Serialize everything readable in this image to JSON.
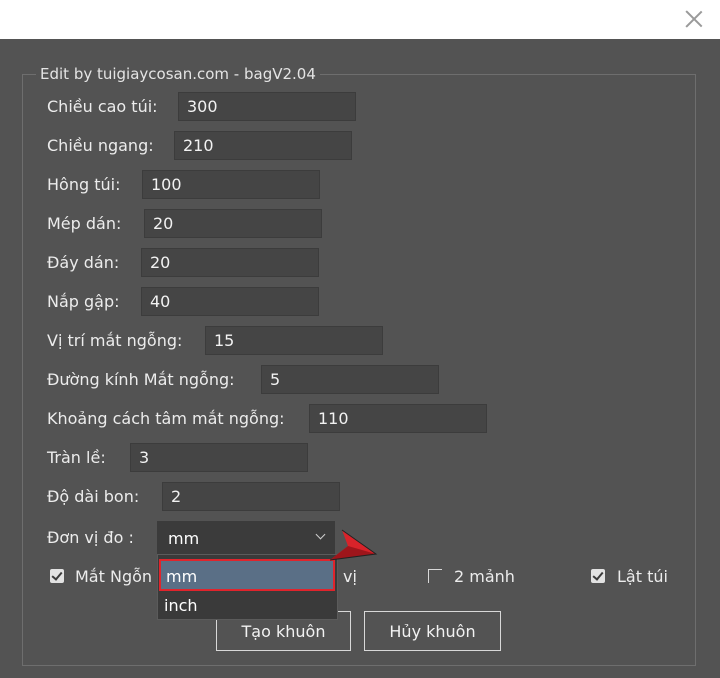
{
  "window": {
    "close_icon": "close-icon"
  },
  "group": {
    "title": "Edit by tuigiaycosan.com - bagV2.04"
  },
  "fields": [
    {
      "label": "Chiều cao túi:",
      "value": "300"
    },
    {
      "label": "Chiều ngang:",
      "value": "210"
    },
    {
      "label": "Hông túi:",
      "value": "100"
    },
    {
      "label": "Mép dán:",
      "value": "20"
    },
    {
      "label": "Đáy dán:",
      "value": "20"
    },
    {
      "label": "Nắp gập:",
      "value": "40"
    },
    {
      "label": "Vị trí mắt ngỗng:",
      "value": "15"
    },
    {
      "label": "Đường kính Mắt ngỗng:",
      "value": "5"
    },
    {
      "label": "Khoảng cách tâm mắt ngỗng:",
      "value": "110"
    },
    {
      "label": "Tràn lề:",
      "value": "3"
    },
    {
      "label": "Độ dài bon:",
      "value": "2"
    }
  ],
  "unit": {
    "label": "Đơn vị đo :",
    "selected": "mm",
    "options": [
      "mm",
      "inch"
    ]
  },
  "checkboxes": {
    "mat_ngong": {
      "label": "Mắt Ngỗn",
      "label_tail": "vị",
      "checked": true
    },
    "hai_manh": {
      "label": "2 mảnh",
      "checked": false
    },
    "lat_tui": {
      "label": "Lật túi",
      "checked": true
    }
  },
  "buttons": {
    "create": "Tạo khuôn",
    "cancel": "Hủy khuôn"
  },
  "colors": {
    "background": "#535353",
    "field": "#454545",
    "highlight": "#5a6f86",
    "annotation_red": "#e0242c"
  }
}
